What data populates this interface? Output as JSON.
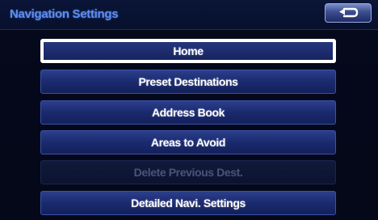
{
  "header": {
    "title": "Navigation Settings",
    "back_icon": "return-arrow-icon"
  },
  "menu": {
    "items": [
      {
        "label": "Home",
        "state": "selected"
      },
      {
        "label": "Preset Destinations",
        "state": "enabled"
      },
      {
        "label": "Address Book",
        "state": "enabled"
      },
      {
        "label": "Areas to Avoid",
        "state": "enabled"
      },
      {
        "label": "Delete Previous Dest.",
        "state": "disabled"
      },
      {
        "label": "Detailed Navi. Settings",
        "state": "enabled"
      }
    ]
  },
  "colors": {
    "background": "#050a1c",
    "title": "#5e8ef0",
    "button": "#1a2a6e",
    "button_border": "#3a52a8",
    "selected_border": "#ffffff",
    "disabled_text": "#4a5478"
  }
}
